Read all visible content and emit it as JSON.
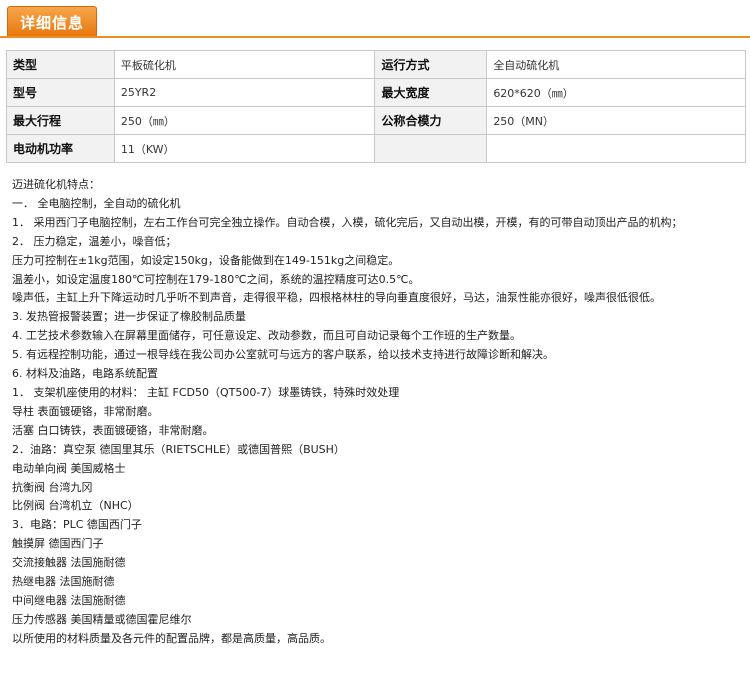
{
  "tab": {
    "label": "详细信息"
  },
  "specs": [
    {
      "k1": "类型",
      "v1": "平板硫化机",
      "k2": "运行方式",
      "v2": "全自动硫化机"
    },
    {
      "k1": "型号",
      "v1": "25YR2",
      "k2": "最大宽度",
      "v2": "620*620（㎜）"
    },
    {
      "k1": "最大行程",
      "v1": "250（㎜）",
      "k2": "公称合模力",
      "v2": "250（MN）"
    },
    {
      "k1": "电动机功率",
      "v1": "11（KW）",
      "k2": "",
      "v2": ""
    }
  ],
  "description": [
    "迈进硫化机特点：",
    "一． 全电脑控制，全自动的硫化机",
    "1． 采用西门子电脑控制，左右工作台可完全独立操作。自动合模，入模，硫化完后，又自动出模，开模，有的可带自动顶出产品的机构；",
    "2． 压力稳定，温差小，噪音低；",
    "压力可控制在±1kg范围，如设定150kg，设备能做到在149-151kg之间稳定。",
    "温差小，如设定温度180℃可控制在179-180℃之间，系统的温控精度可达0.5℃。",
    "噪声低，主缸上升下降运动时几乎听不到声音，走得很平稳，四根格林柱的导向垂直度很好，马达，油泵性能亦很好，噪声很低很低。",
    "3. 发热管报警装置；进一步保证了橡胶制品质量",
    "4. 工艺技术参数输入在屏幕里面储存，可任意设定、改动参数，而且可自动记录每个工作班的生产数量。",
    "5. 有远程控制功能，通过一根导线在我公司办公室就可与远方的客户联系，给以技术支持进行故障诊断和解决。",
    "6. 材料及油路，电路系统配置",
    "1． 支架机座使用的材料： 主缸 FCD50（QT500-7）球墨铸铁，特殊时效处理",
    "导柱 表面镀硬铬，非常耐磨。",
    "活塞 白口铸铁，表面镀硬铬，非常耐磨。",
    "2．油路：真空泵 德国里其乐（RIETSCHLE）或德国普熙（BUSH）",
    "电动单向阀 美国威格士",
    "抗衡阀 台湾九冈",
    "比例阀 台湾机立（NHC）",
    "3．电路：PLC 德国西门子",
    "触摸屏 德国西门子",
    "交流接触器 法国施耐德",
    "热继电器 法国施耐德",
    "中间继电器 法国施耐德",
    "压力传感器 美国精量或德国霍尼维尔",
    "以所使用的材料质量及各元件的配置品牌，都是高质量，高品质。"
  ]
}
